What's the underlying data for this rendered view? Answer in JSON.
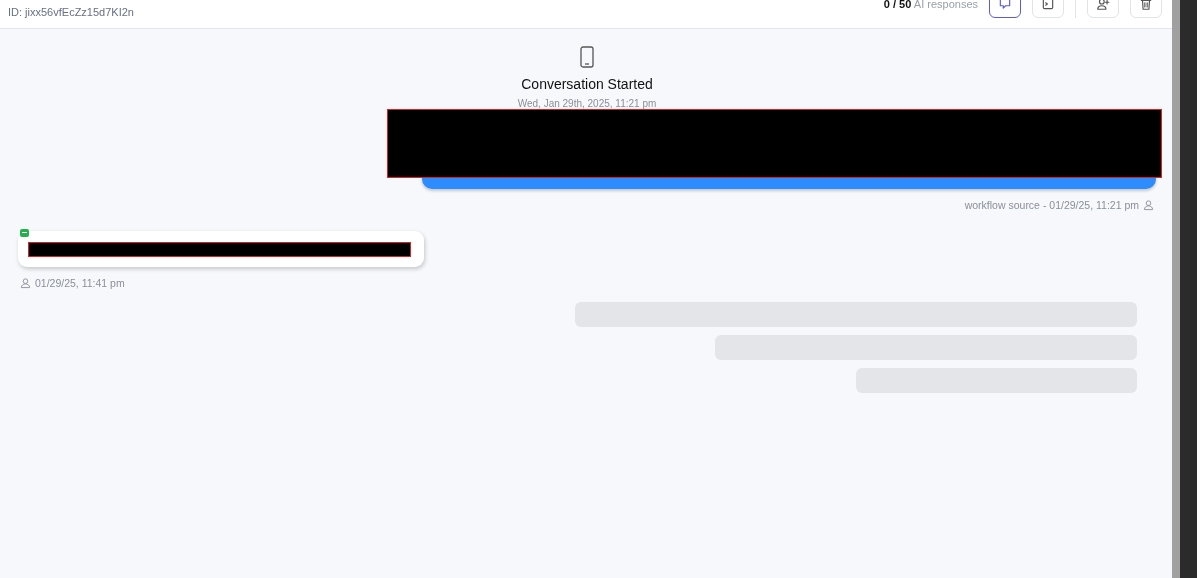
{
  "header": {
    "id_label": "ID: jixx56vfEcZz15d7KI2n",
    "usage": {
      "count": "0 / 50",
      "label": "AI responses"
    },
    "actions": [
      {
        "kind": "chat",
        "selected": true
      },
      {
        "kind": "terminal",
        "selected": false
      },
      {
        "kind": "add-user",
        "selected": false
      },
      {
        "kind": "trash",
        "selected": false
      }
    ]
  },
  "conversation_start": {
    "title": "Conversation Started",
    "time": "Wed, Jan 29th, 2025, 11:21 pm"
  },
  "messages": [
    {
      "kind": "outbound",
      "redacted": true,
      "meta": "workflow source - 01/29/25, 11:21 pm"
    },
    {
      "kind": "inbound",
      "redacted": true,
      "meta": "01/29/25, 11:41 pm"
    }
  ]
}
